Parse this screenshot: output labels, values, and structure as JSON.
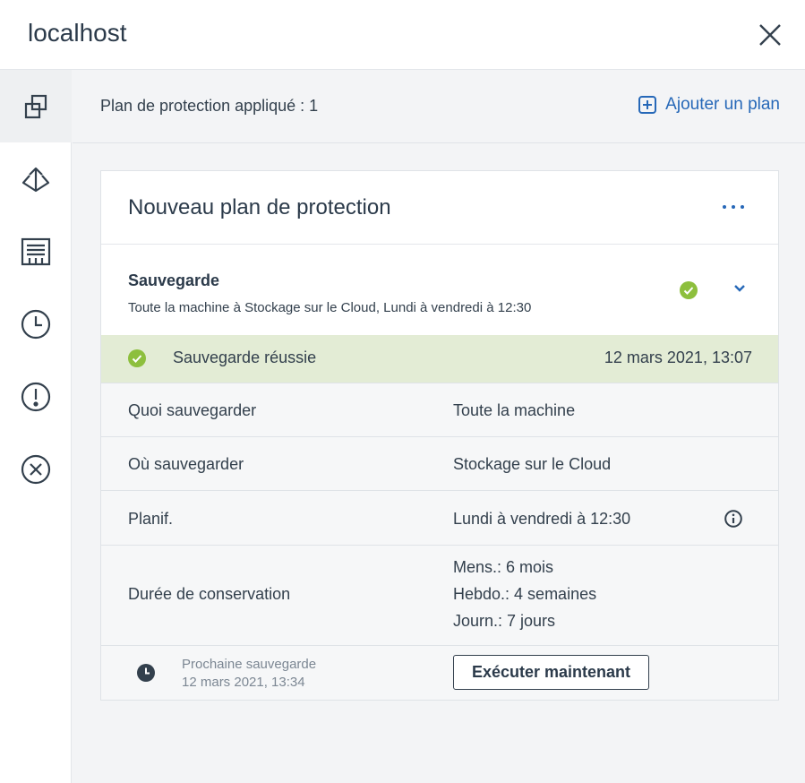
{
  "window": {
    "title": "localhost"
  },
  "sidebar": {
    "items": [
      {
        "icon": "protection-plans-icon",
        "active": true
      },
      {
        "icon": "recovery-icon",
        "active": false
      },
      {
        "icon": "activities-icon",
        "active": false
      },
      {
        "icon": "history-icon",
        "active": false
      },
      {
        "icon": "alerts-icon",
        "active": false
      },
      {
        "icon": "cancel-icon",
        "active": false
      }
    ]
  },
  "topbar": {
    "plan_count": "Plan de protection appliqué : 1",
    "add_plan_label": "Ajouter un plan"
  },
  "plan": {
    "title": "Nouveau plan de protection",
    "section_title": "Sauvegarde",
    "section_summary": "Toute la machine à Stockage sur le Cloud, Lundi à vendredi à 12:30",
    "status": {
      "label": "Sauvegarde réussie",
      "date": "12 mars 2021, 13:07"
    },
    "details": {
      "what_label": "Quoi sauvegarder",
      "what_value": "Toute la machine",
      "where_label": "Où sauvegarder",
      "where_value": "Stockage sur le Cloud",
      "schedule_label": "Planif.",
      "schedule_value": "Lundi à vendredi à 12:30",
      "retention_label": "Durée de conservation",
      "retention_values": [
        "Mens.: 6 mois",
        "Hebdo.: 4 semaines",
        "Journ.: 7 jours"
      ]
    },
    "next_backup": {
      "label": "Prochaine sauvegarde",
      "date": "12 mars 2021, 13:34"
    },
    "run_now_label": "Exécuter maintenant"
  },
  "colors": {
    "accent": "#2668b8",
    "success": "#8dbf3d",
    "success_row": "#e3ecd5",
    "icon": "#33404d"
  }
}
